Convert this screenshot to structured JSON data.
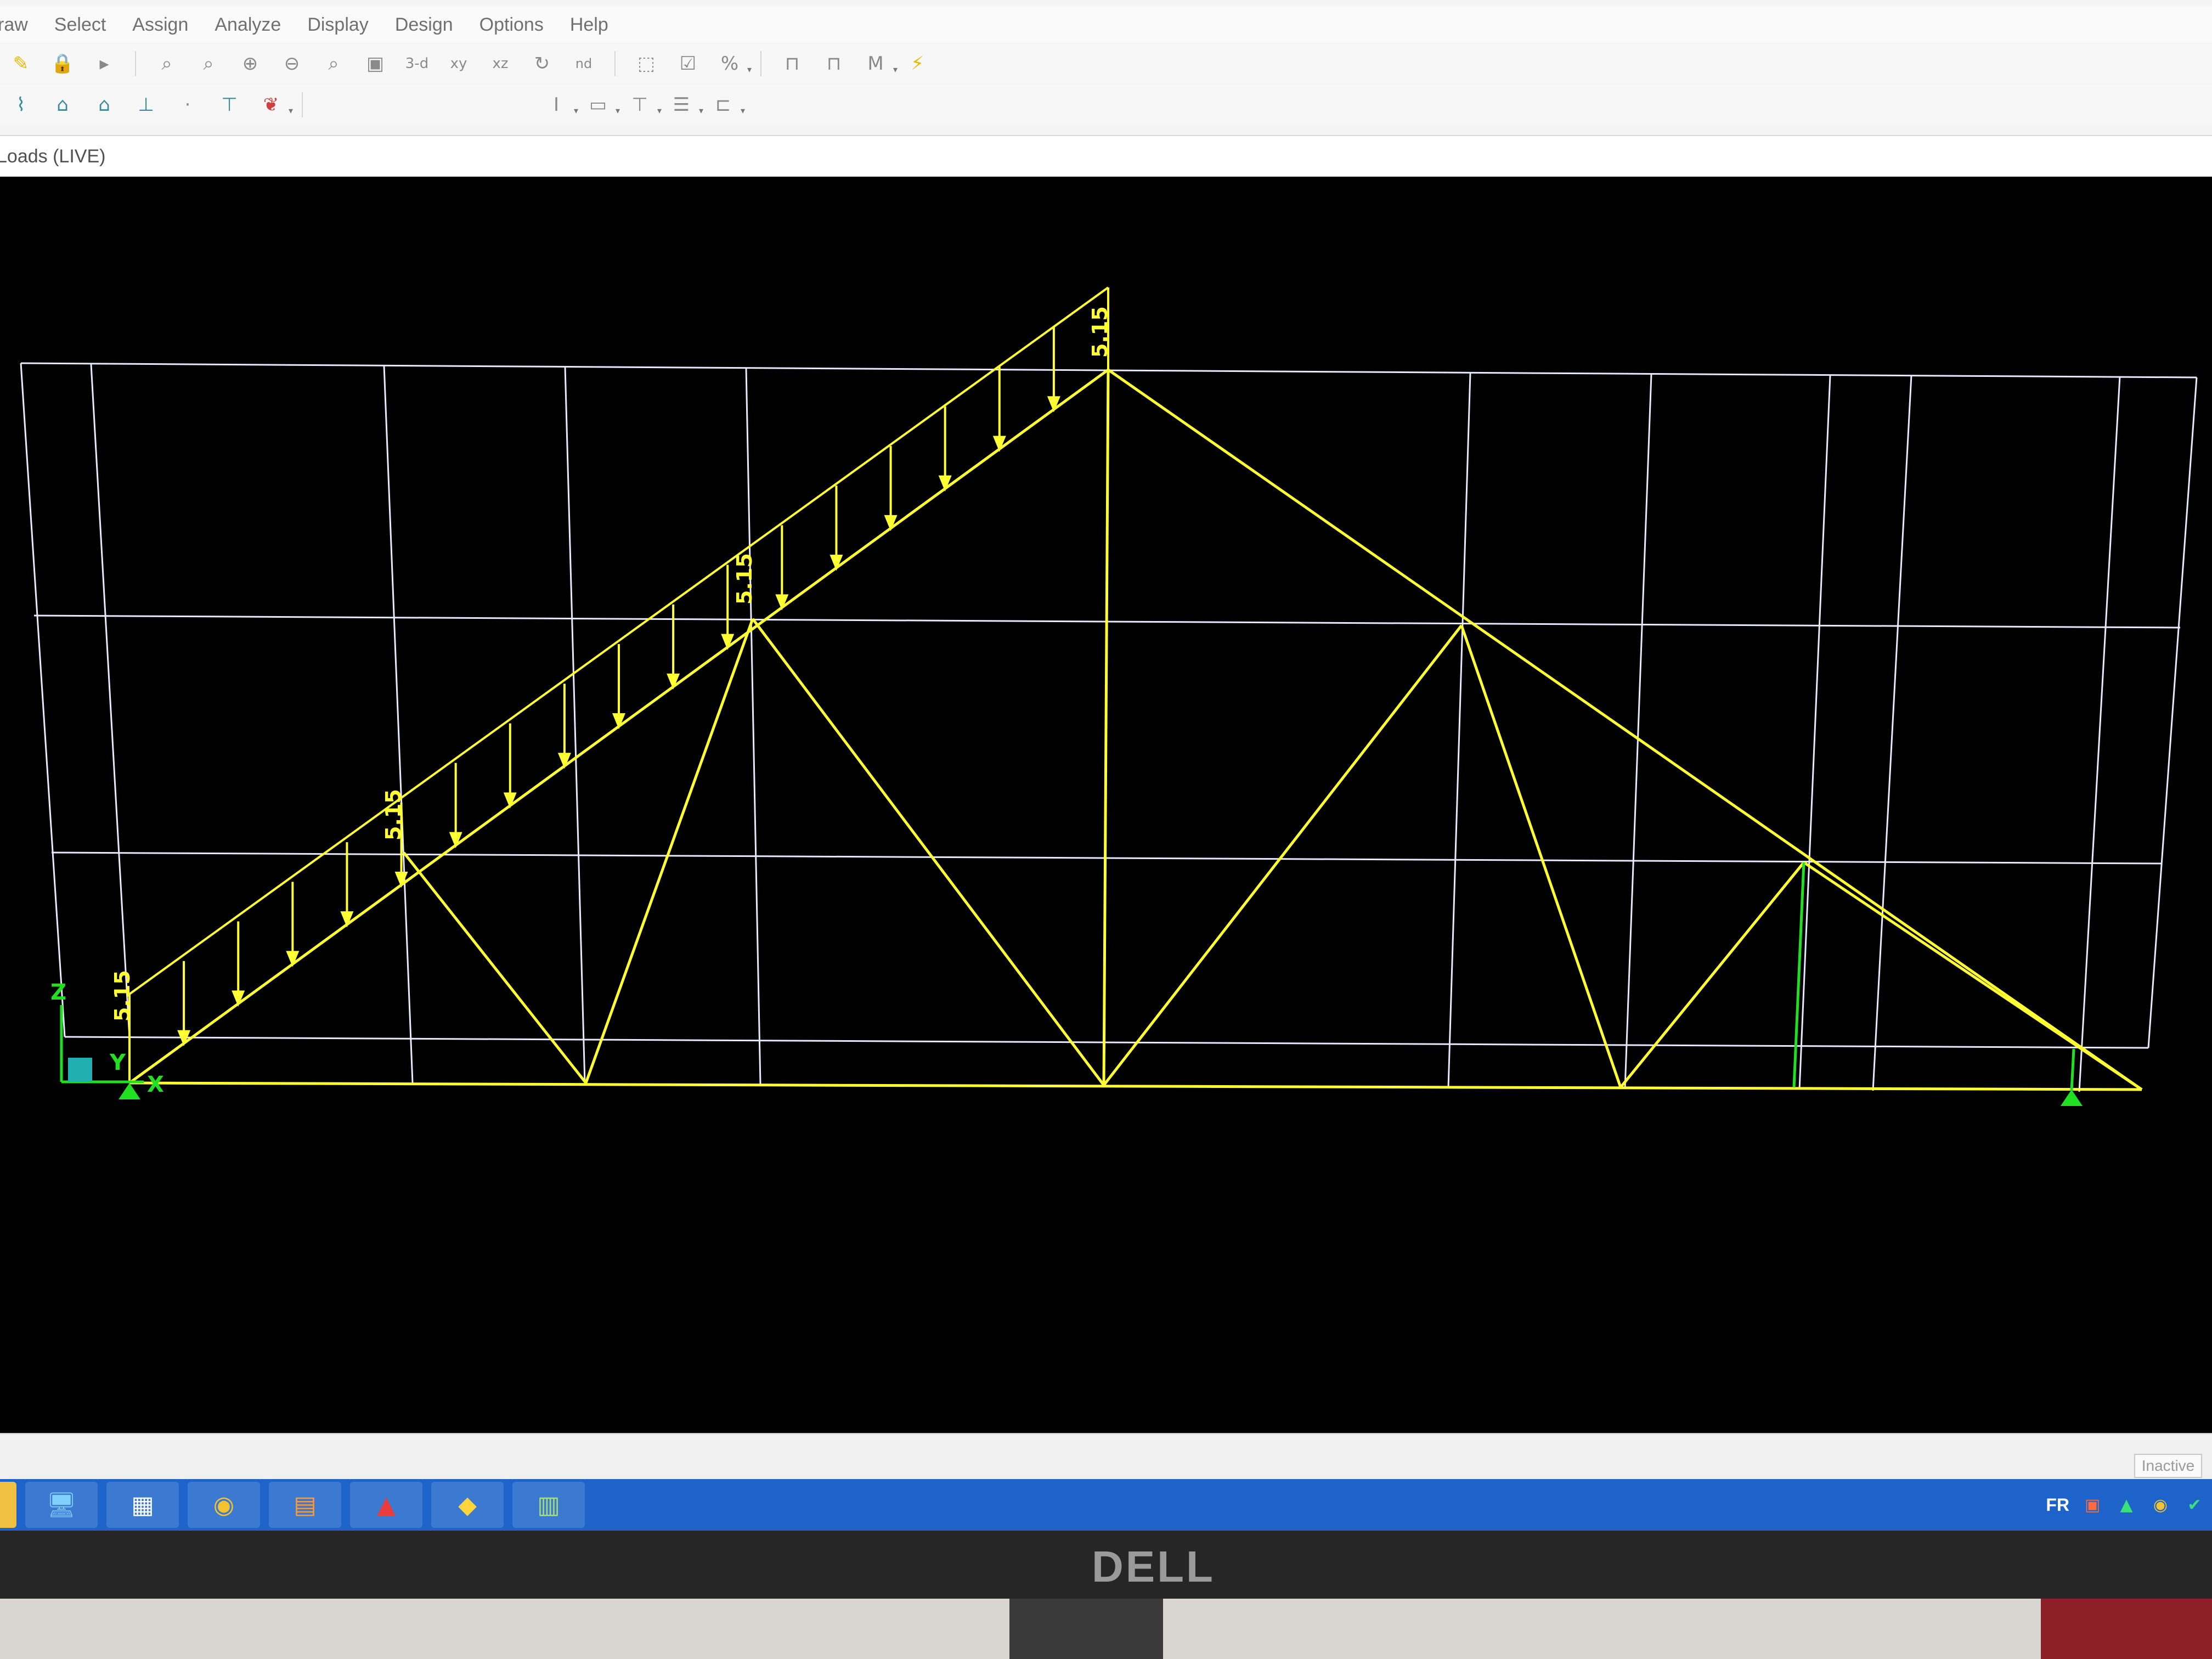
{
  "menu": {
    "items": [
      "raw",
      "Select",
      "Assign",
      "Analyze",
      "Display",
      "Design",
      "Options",
      "Help"
    ]
  },
  "toolbar1": {
    "icons": [
      "pencil-icon",
      "lock-icon",
      "play-icon",
      "zoom-window-icon",
      "zoom-restore-icon",
      "zoom-in-icon",
      "zoom-out-icon",
      "zoom-extents-icon",
      "pan-icon",
      "view-3d-icon",
      "view-xy-icon",
      "view-xz-icon",
      "rotate-icon",
      "view-options-icon",
      "select-icon",
      "checkbox-icon",
      "percent-icon",
      "frame-icon",
      "frame2-icon",
      "moment-icon",
      "run-analysis-icon"
    ],
    "labels": {
      "view_3d": "3-d",
      "view_xy": "xy",
      "view_xz": "xz",
      "view_nd": "nd"
    }
  },
  "toolbar2": {
    "icons": [
      "draw-frame-icon",
      "draw-section-icon",
      "draw-area-icon",
      "draw-link-icon",
      "draw-joint-icon",
      "assign-load-icon",
      "text-cursor-icon",
      "rectangle-icon",
      "filter-icon",
      "list-icon",
      "copy-icon"
    ]
  },
  "window": {
    "title": "Loads (LIVE)"
  },
  "model": {
    "load_label": "5.15",
    "load_pattern": "LIVE",
    "axis_labels": {
      "x": "X",
      "y": "Y",
      "z": "Z"
    }
  },
  "status": {
    "right_box": "Inactive"
  },
  "taskbar": {
    "icons": [
      "file-explorer-icon",
      "remote-desktop-icon",
      "apps-grid-icon",
      "chrome-icon",
      "sap2000-icon",
      "autocad-icon",
      "civil-app-icon",
      "analysis-app-icon"
    ],
    "tray": {
      "language": "FR"
    }
  },
  "monitor": {
    "brand": "DELL"
  },
  "colors": {
    "structure": "#ffff33",
    "grid": "#e8e8ff",
    "axis": "#21e021",
    "viewport_bg": "#000000",
    "taskbar": "#1d63c9"
  }
}
